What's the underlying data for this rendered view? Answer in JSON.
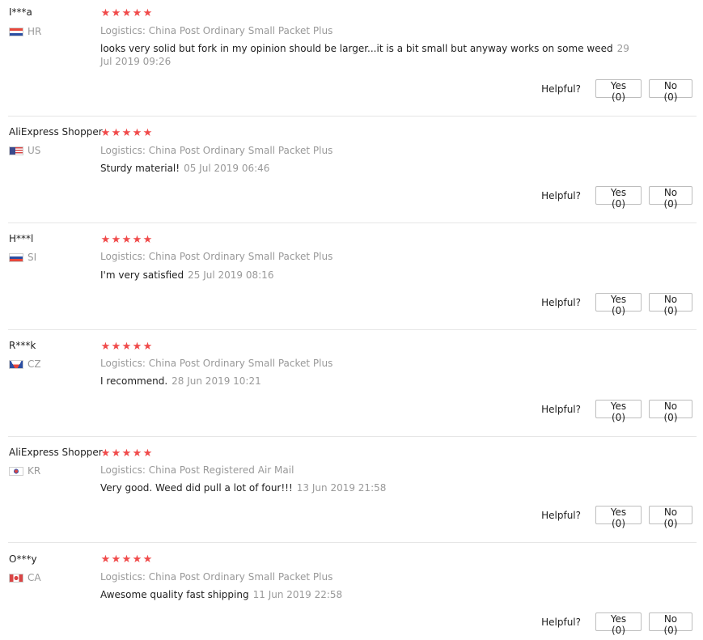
{
  "helpful_label": "Helpful?",
  "reviews": [
    {
      "user": "I***a",
      "country": "HR",
      "stars": 5,
      "logistics": "Logistics: China Post Ordinary Small Packet Plus",
      "feedback": "looks very solid but fork in my opinion should be larger...it is a bit small but anyway works on some weed",
      "date": "29 Jul 2019 09:26",
      "yes": "Yes (0)",
      "no": "No (0)"
    },
    {
      "user": "AliExpress Shopper",
      "country": "US",
      "stars": 5,
      "logistics": "Logistics: China Post Ordinary Small Packet Plus",
      "feedback": "Sturdy material!",
      "date": "05 Jul 2019 06:46",
      "yes": "Yes (0)",
      "no": "No (0)"
    },
    {
      "user": "H***l",
      "country": "SI",
      "stars": 5,
      "logistics": "Logistics: China Post Ordinary Small Packet Plus",
      "feedback": "I'm very satisfied",
      "date": "25 Jul 2019 08:16",
      "yes": "Yes (0)",
      "no": "No (0)"
    },
    {
      "user": "R***k",
      "country": "CZ",
      "stars": 5,
      "logistics": "Logistics: China Post Ordinary Small Packet Plus",
      "feedback": "I recommend.",
      "date": "28 Jun 2019 10:21",
      "yes": "Yes (0)",
      "no": "No (0)"
    },
    {
      "user": "AliExpress Shopper",
      "country": "KR",
      "stars": 5,
      "logistics": "Logistics: China Post Registered Air Mail",
      "feedback": "Very good. Weed did pull a lot of four!!!",
      "date": "13 Jun 2019 21:58",
      "yes": "Yes (0)",
      "no": "No (0)"
    },
    {
      "user": "O***y",
      "country": "CA",
      "stars": 5,
      "logistics": "Logistics: China Post Ordinary Small Packet Plus",
      "feedback": "Awesome quality fast shipping",
      "date": "11 Jun 2019 22:58",
      "yes": "Yes (0)",
      "no": "No (0)"
    }
  ],
  "colors": {
    "star": "#f04a4a",
    "muted_text": "#999999",
    "divider": "#e6e6e6"
  }
}
